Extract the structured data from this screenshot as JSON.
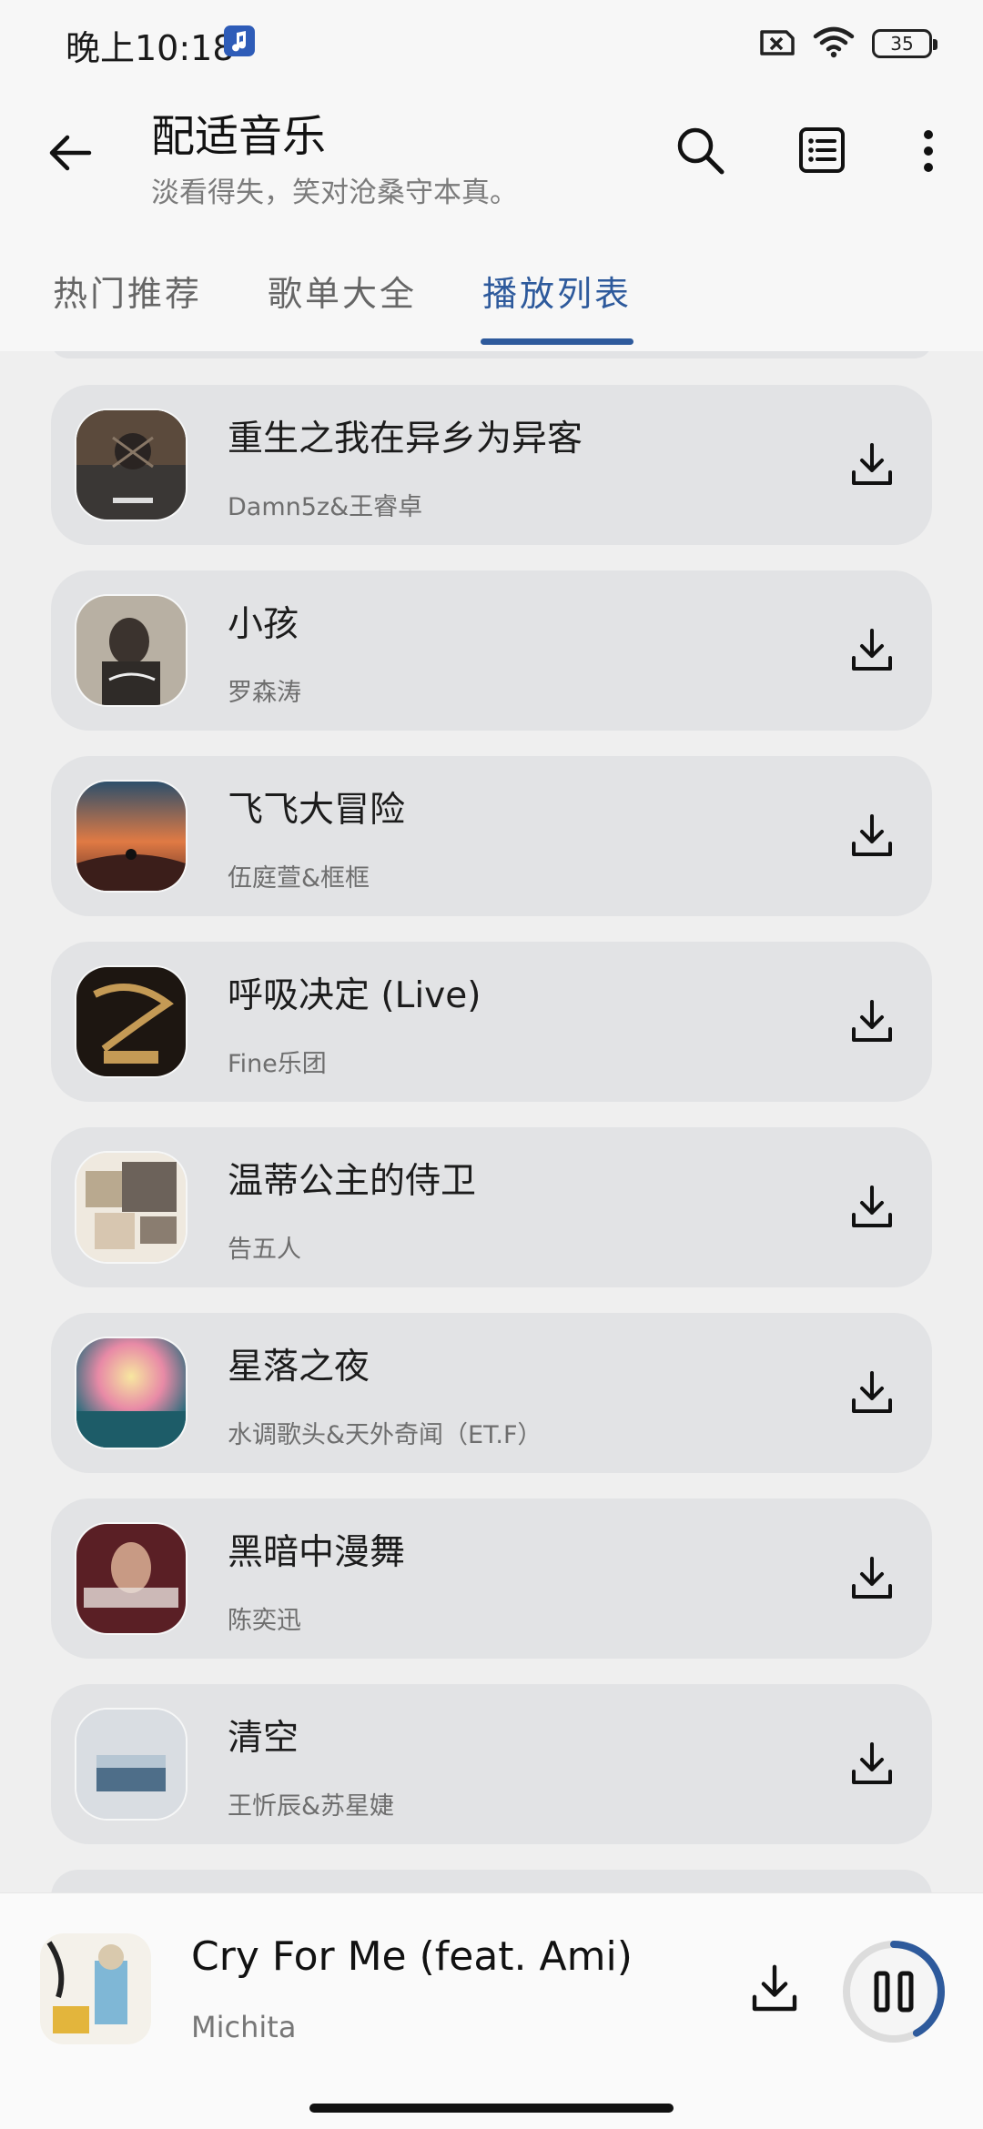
{
  "status": {
    "time": "晚上10:18",
    "battery": "35"
  },
  "header": {
    "title": "配适音乐",
    "subtitle": "淡看得失，笑对沧桑守本真。"
  },
  "tabs": [
    {
      "label": "热门推荐"
    },
    {
      "label": "歌单大全"
    },
    {
      "label": "播放列表"
    }
  ],
  "active_tab": "播放列表",
  "songs": [
    {
      "title": "重生之我在异乡为异客",
      "artist": "Damn5z&王睿卓"
    },
    {
      "title": "小孩",
      "artist": "罗森涛"
    },
    {
      "title": "飞飞大冒险",
      "artist": "伍庭萱&框框"
    },
    {
      "title": "呼吸决定 (Live)",
      "artist": "Fine乐团"
    },
    {
      "title": "温蒂公主的侍卫",
      "artist": "告五人"
    },
    {
      "title": "星落之夜",
      "artist": "水调歌头&天外奇闻（ET.F）"
    },
    {
      "title": "黑暗中漫舞",
      "artist": "陈奕迅"
    },
    {
      "title": "清空",
      "artist": "王忻辰&苏星婕"
    }
  ],
  "player": {
    "title": "Cry For Me (feat. Ami)",
    "artist": "Michita",
    "progress": 0.42
  },
  "colors": {
    "accent": "#2e5a9c",
    "card": "#e2e3e5",
    "background": "#efefef"
  }
}
